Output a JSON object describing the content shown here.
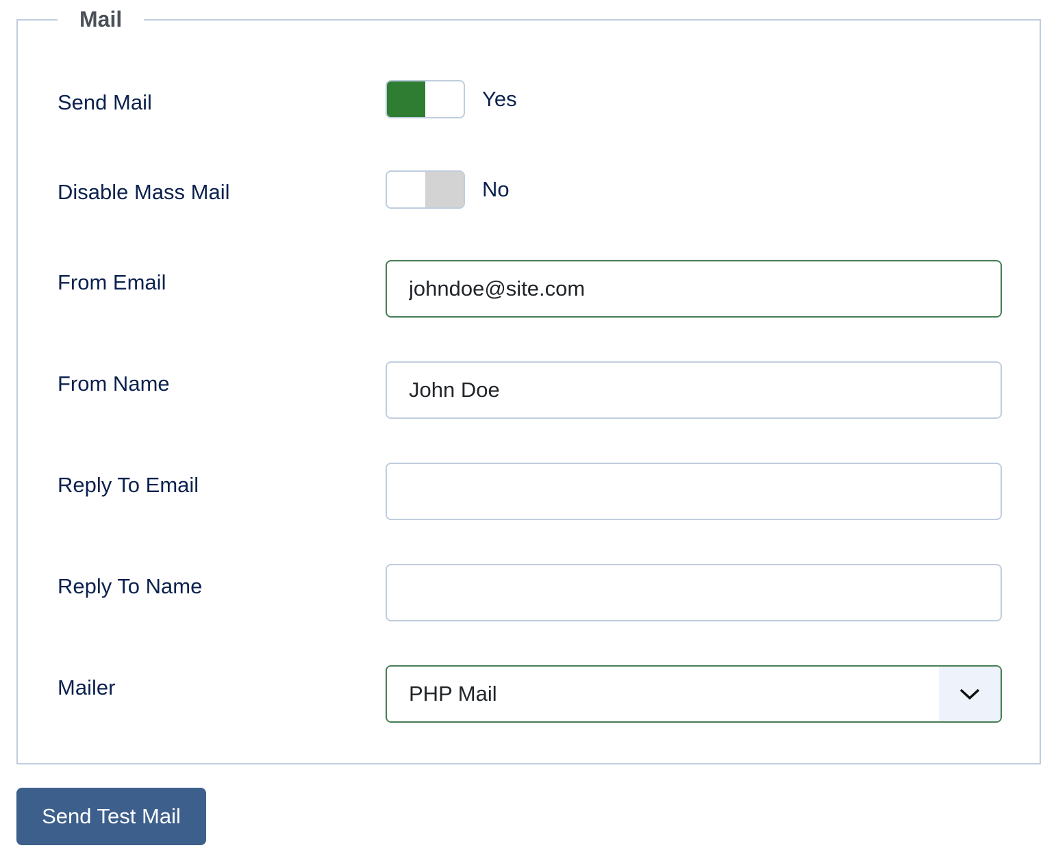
{
  "fieldset": {
    "legend": "Mail"
  },
  "fields": {
    "send_mail": {
      "label": "Send Mail",
      "state_label": "Yes",
      "value": true
    },
    "disable_mass_mail": {
      "label": "Disable Mass Mail",
      "state_label": "No",
      "value": false
    },
    "from_email": {
      "label": "From Email",
      "value": "johndoe@site.com",
      "placeholder": ""
    },
    "from_name": {
      "label": "From Name",
      "value": "John Doe",
      "placeholder": ""
    },
    "reply_to_email": {
      "label": "Reply To Email",
      "value": "",
      "placeholder": ""
    },
    "reply_to_name": {
      "label": "Reply To Name",
      "value": "",
      "placeholder": ""
    },
    "mailer": {
      "label": "Mailer",
      "selected": "PHP Mail",
      "icon": "chevron-down-icon"
    }
  },
  "actions": {
    "send_test_mail": "Send Test Mail"
  },
  "colors": {
    "toggle_on": "#2f7d32",
    "toggle_off": "#d3d3d3",
    "valid_border": "#457d54",
    "button": "#3d5f8c",
    "label_text": "#0b214e"
  }
}
